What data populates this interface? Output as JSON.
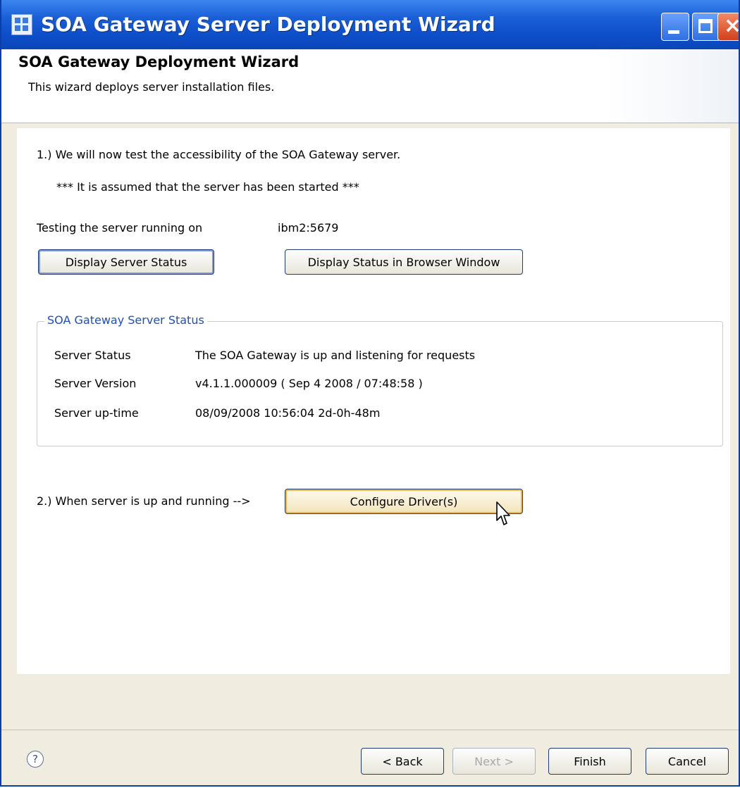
{
  "window": {
    "title": "SOA Gateway Server Deployment Wizard"
  },
  "header": {
    "title": "SOA Gateway Deployment Wizard",
    "description": "This wizard deploys server installation files."
  },
  "step1": {
    "intro": "1.) We will now test the accessibility of the SOA Gateway server.",
    "assumption": "*** It is assumed that the server has been started ***",
    "testing_label": "Testing the server running on",
    "server_address": "ibm2:5679",
    "display_status_label": "Display Server Status",
    "display_browser_label": "Display Status in Browser Window"
  },
  "status_group": {
    "title": "SOA Gateway Server Status",
    "rows": [
      {
        "label": "Server Status",
        "value": "The SOA Gateway is up and listening for requests"
      },
      {
        "label": "Server Version",
        "value": "v4.1.1.000009 ( Sep  4 2008 / 07:48:58 )"
      },
      {
        "label": "Server up-time",
        "value": "08/09/2008   10:56:04   2d-0h-48m"
      }
    ]
  },
  "step2": {
    "label": "2.) When server is up and running -->",
    "configure_label": "Configure Driver(s)"
  },
  "footer": {
    "help_symbol": "?",
    "back_label": "< Back",
    "next_label": "Next >",
    "finish_label": "Finish",
    "cancel_label": "Cancel"
  },
  "colors": {
    "titlebar": "#0d4ec9",
    "group_title": "#1c4fb8",
    "dialog_bg": "#f0ecdf"
  }
}
